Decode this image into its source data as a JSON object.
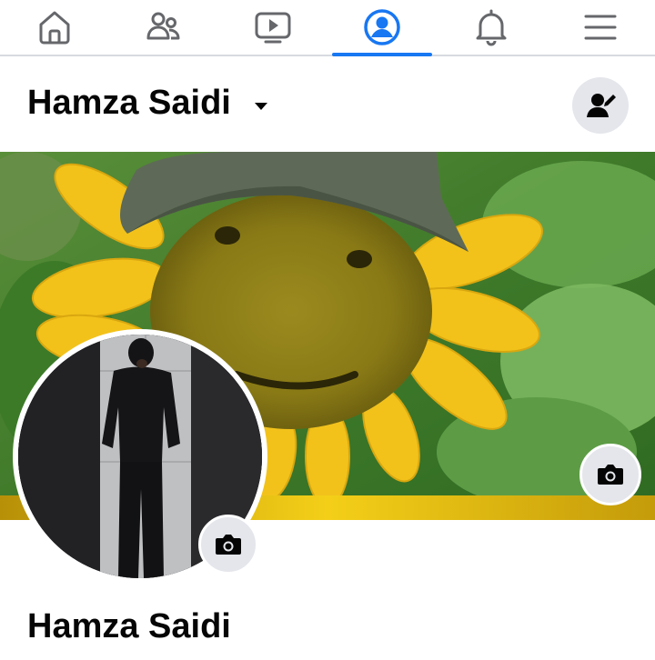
{
  "nav": {
    "items": [
      {
        "icon": "home-icon"
      },
      {
        "icon": "friends-icon"
      },
      {
        "icon": "watch-icon"
      },
      {
        "icon": "profile-icon",
        "active": true
      },
      {
        "icon": "bell-icon"
      },
      {
        "icon": "menu-icon"
      }
    ],
    "accent": "#1877f2"
  },
  "header": {
    "name": "Hamza Saidi"
  },
  "profile": {
    "name": "Hamza Saidi"
  }
}
